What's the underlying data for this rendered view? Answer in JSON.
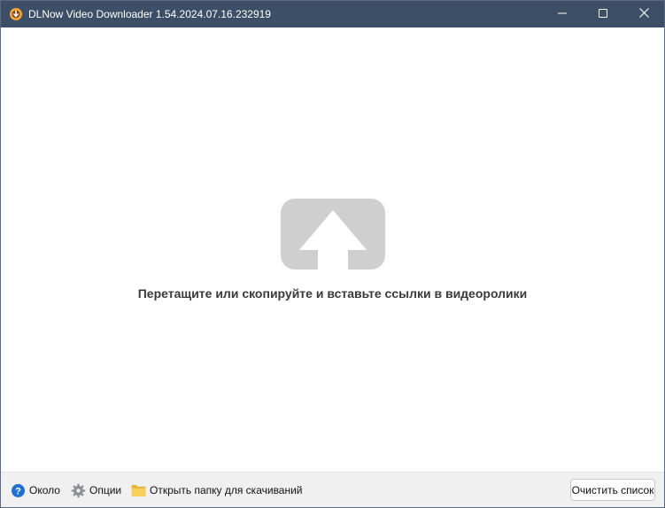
{
  "window": {
    "title": "DLNow Video Downloader 1.54.2024.07.16.232919",
    "controls": {
      "minimize_icon": "minimize-icon",
      "maximize_icon": "maximize-icon",
      "close_icon": "close-icon"
    }
  },
  "main": {
    "drop_icon": "upload-arrow-icon",
    "drop_text": "Перетащите или скопируйте и вставьте ссылки в видеоролики"
  },
  "bottombar": {
    "about_label": "Около",
    "options_label": "Опции",
    "open_folder_label": "Открыть папку для скачиваний",
    "clear_list_label": "Очистить список"
  },
  "colors": {
    "titlebar": "#3d4f66",
    "drop_icon": "#cfcfcf",
    "bottombar": "#f0f0f0"
  }
}
